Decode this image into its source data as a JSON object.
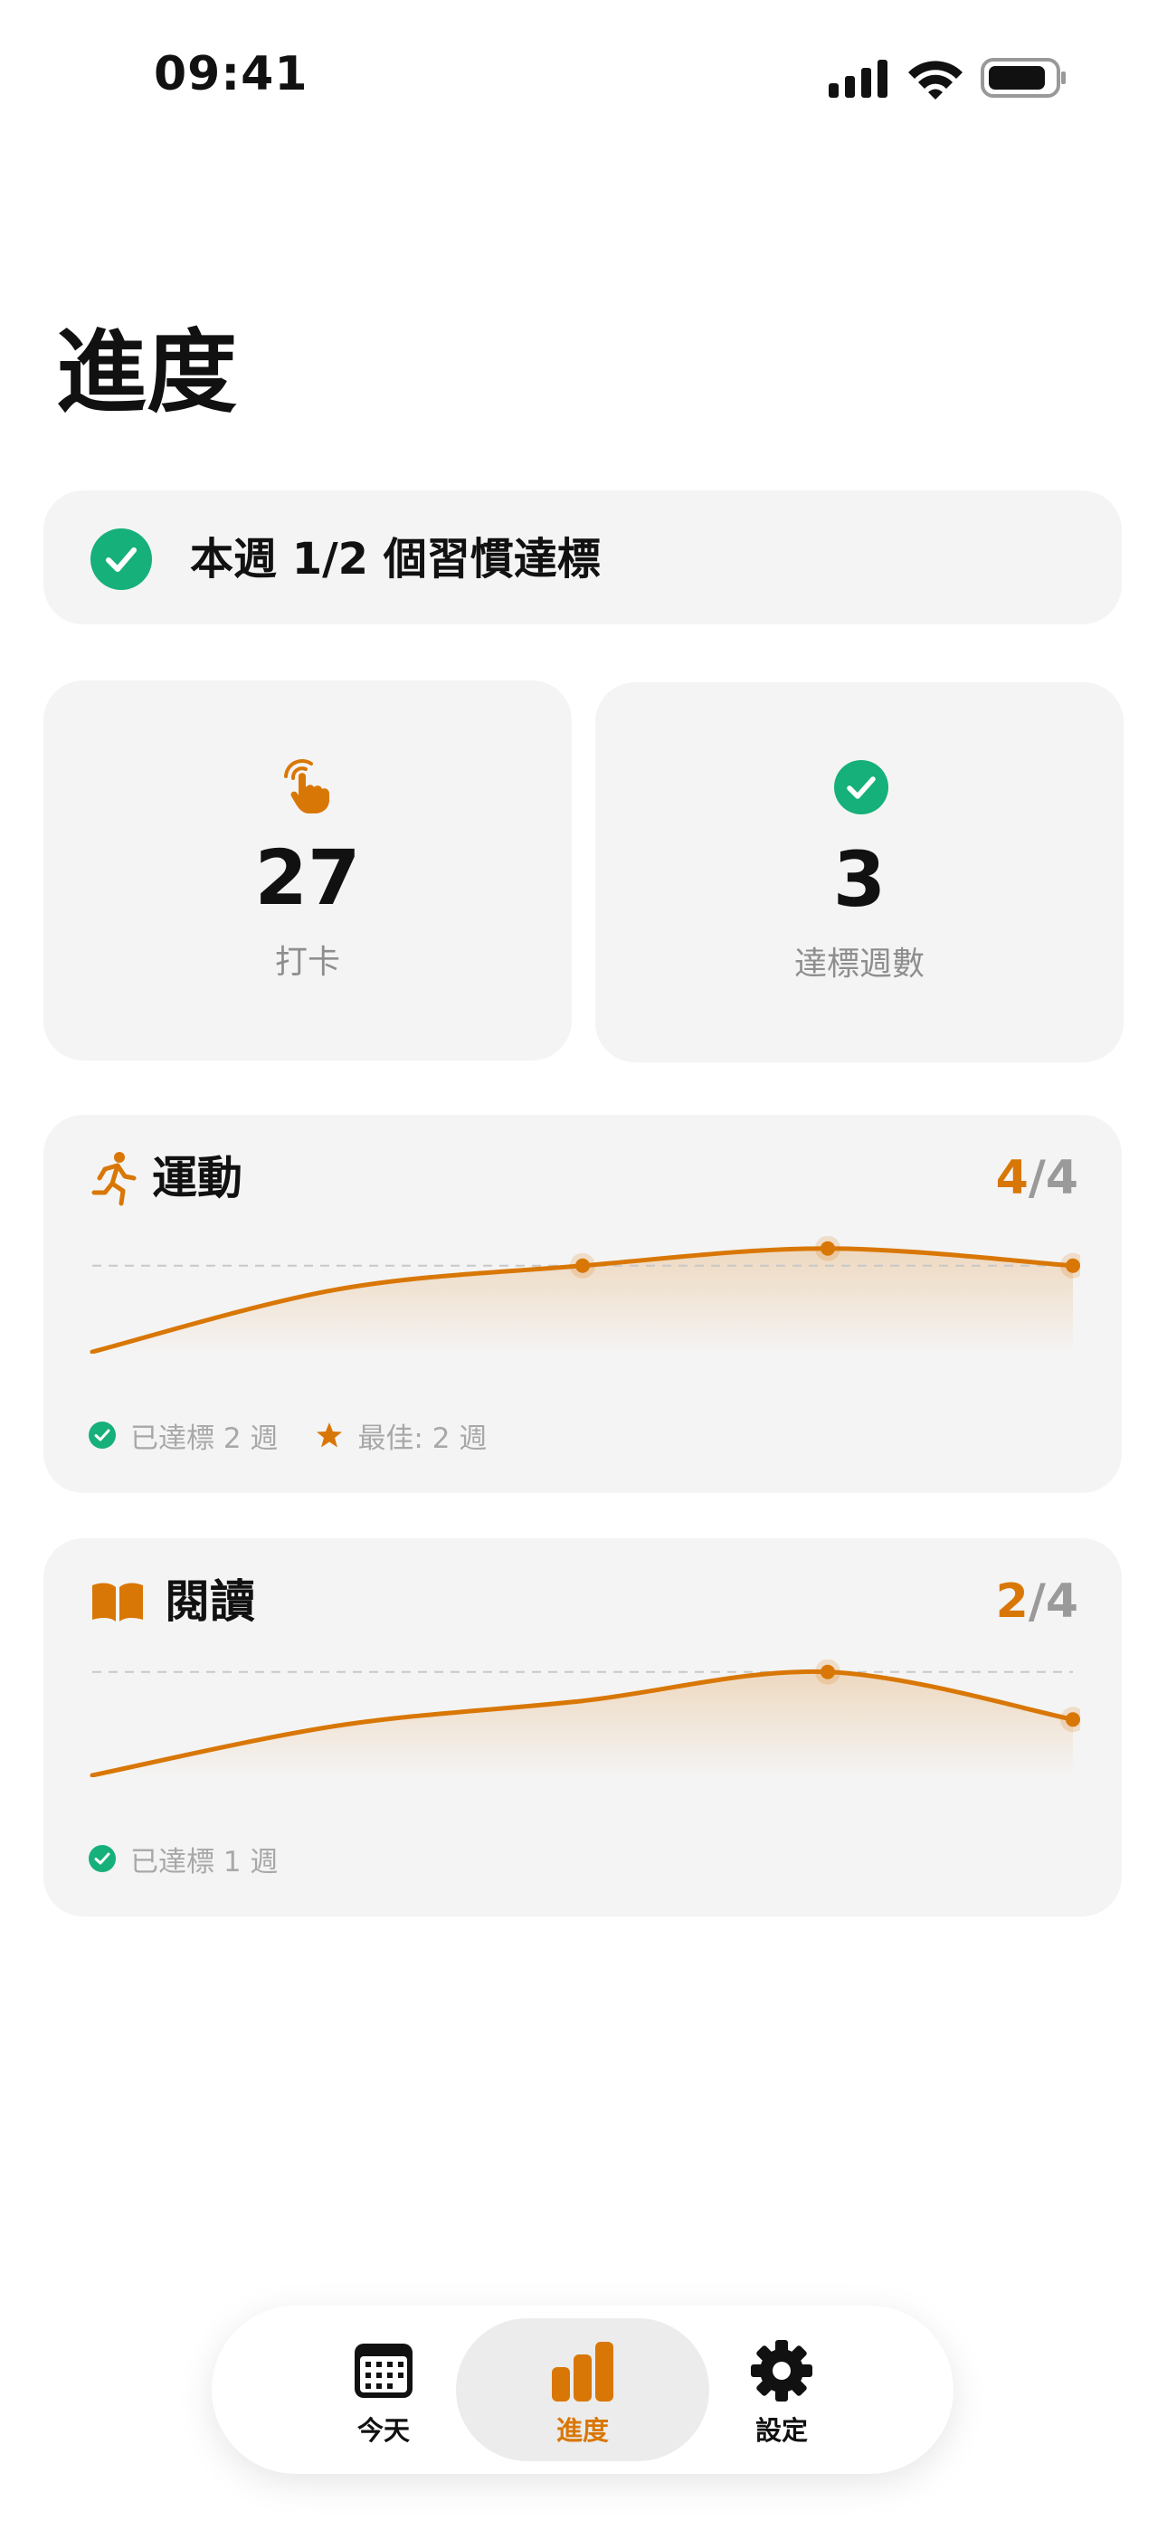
{
  "status_bar": {
    "time": "09:41"
  },
  "page": {
    "title": "進度"
  },
  "summary": {
    "text": "本週 1/2 個習慣達標"
  },
  "stats": [
    {
      "icon": "tap-hand-icon",
      "value": "27",
      "label": "打卡"
    },
    {
      "icon": "check-circle-icon",
      "value": "3",
      "label": "達標週數"
    }
  ],
  "habits": [
    {
      "icon": "running-icon",
      "title": "運動",
      "count_done": "4",
      "count_sep": "/",
      "count_total": "4",
      "achieved_text": "已達標 2 週",
      "best_text": "最佳: 2 週",
      "chart_data": {
        "type": "line",
        "x": [
          1,
          2,
          3,
          4,
          5
        ],
        "values": [
          0,
          2.9,
          4,
          4.8,
          4
        ],
        "target": 4,
        "markers": [
          3,
          4,
          5
        ]
      }
    },
    {
      "icon": "book-icon",
      "title": "閱讀",
      "count_done": "2",
      "count_sep": "/",
      "count_total": "4",
      "achieved_text": "已達標 1 週",
      "chart_data": {
        "type": "line",
        "x": [
          1,
          2,
          3,
          4,
          5
        ],
        "values": [
          0,
          2.4,
          3.6,
          5,
          2.7
        ],
        "target": 5,
        "markers": [
          4,
          5
        ]
      }
    }
  ],
  "tabbar": {
    "items": [
      {
        "label": "今天",
        "icon": "calendar-icon"
      },
      {
        "label": "進度",
        "icon": "bar-chart-icon"
      },
      {
        "label": "設定",
        "icon": "gear-icon"
      }
    ],
    "active": 1
  },
  "colors": {
    "accent": "#d97706",
    "success": "#16b07a",
    "card": "#f4f4f4"
  }
}
